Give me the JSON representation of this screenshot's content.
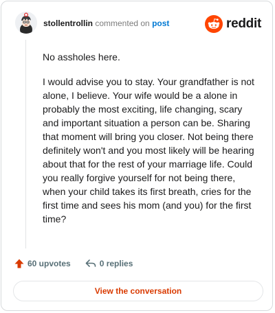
{
  "comment": {
    "username": "stollentrollin",
    "verb": "commented on",
    "post_link": "post",
    "paragraphs": [
      "No assholes here.",
      "I would advise you to stay. Your grandfather is not alone, I believe. Your wife would be a alone in probably the most exciting, life changing, scary and important situation a person can be. Sharing that moment will bring you closer. Not being there definitely won't and you most likely will be hearing about that for the rest of your marriage life. Could you really forgive yourself for not being there, when your child takes its first breath, cries for the first time and sees his mom (and you) for the first time?"
    ]
  },
  "brand": {
    "name": "reddit",
    "icon": "reddit-snoo-icon",
    "color": "#ff4500"
  },
  "actions": {
    "upvotes": "60 upvotes",
    "replies": "0 replies"
  },
  "cta": {
    "label": "View the conversation"
  },
  "colors": {
    "accent": "#d93a00",
    "link": "#0079d3",
    "muted": "#576f76"
  }
}
